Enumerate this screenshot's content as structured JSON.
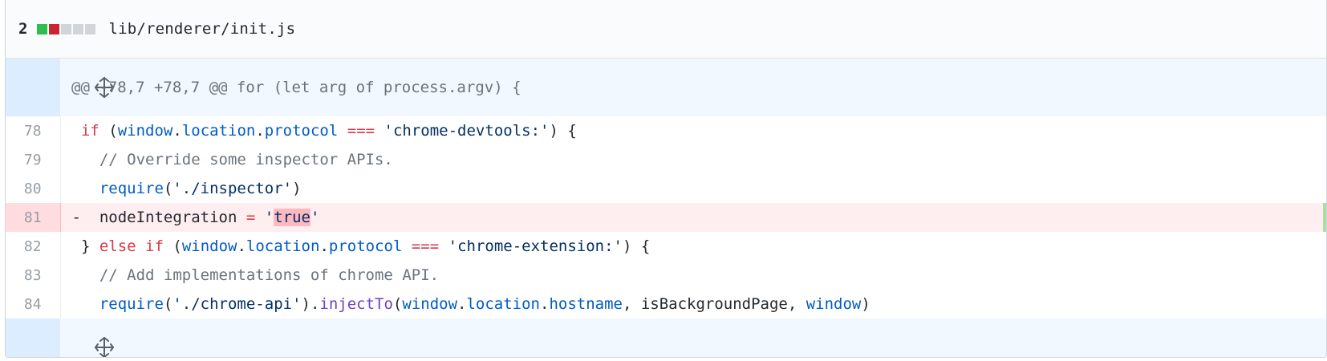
{
  "file": {
    "change_count": "2",
    "path": "lib/renderer/init.js",
    "diffstat_colors": [
      "#2cbe4e",
      "#cb2431",
      "#d1d5da",
      "#d1d5da",
      "#d1d5da"
    ]
  },
  "hunk": {
    "header": "@@ -78,7 +78,7 @@ for (let arg of process.argv) {"
  },
  "lines": [
    {
      "num": "78",
      "tokens": [
        {
          "t": " ",
          "c": ""
        },
        {
          "t": "if",
          "c": "kw"
        },
        {
          "t": " (",
          "c": ""
        },
        {
          "t": "window",
          "c": "id"
        },
        {
          "t": ".",
          "c": ""
        },
        {
          "t": "location",
          "c": "id"
        },
        {
          "t": ".",
          "c": ""
        },
        {
          "t": "protocol",
          "c": "id"
        },
        {
          "t": " ",
          "c": ""
        },
        {
          "t": "===",
          "c": "kw"
        },
        {
          "t": " ",
          "c": ""
        },
        {
          "t": "'chrome-devtools:'",
          "c": "str"
        },
        {
          "t": ") {",
          "c": ""
        }
      ]
    },
    {
      "num": "79",
      "tokens": [
        {
          "t": "   ",
          "c": ""
        },
        {
          "t": "// Override some inspector APIs.",
          "c": "cm"
        }
      ]
    },
    {
      "num": "80",
      "tokens": [
        {
          "t": "   ",
          "c": ""
        },
        {
          "t": "require",
          "c": "id"
        },
        {
          "t": "(",
          "c": ""
        },
        {
          "t": "'./inspector'",
          "c": "str"
        },
        {
          "t": ")",
          "c": ""
        }
      ]
    },
    {
      "num": "81",
      "deleted": true,
      "tokens": [
        {
          "t": "-  nodeIntegration ",
          "c": ""
        },
        {
          "t": "=",
          "c": "kw"
        },
        {
          "t": " ",
          "c": ""
        },
        {
          "t": "'",
          "c": "str"
        },
        {
          "t": "true",
          "c": "str",
          "hl": true
        },
        {
          "t": "'",
          "c": "str"
        }
      ]
    },
    {
      "num": "82",
      "tokens": [
        {
          "t": " } ",
          "c": ""
        },
        {
          "t": "else",
          "c": "kw"
        },
        {
          "t": " ",
          "c": ""
        },
        {
          "t": "if",
          "c": "kw"
        },
        {
          "t": " (",
          "c": ""
        },
        {
          "t": "window",
          "c": "id"
        },
        {
          "t": ".",
          "c": ""
        },
        {
          "t": "location",
          "c": "id"
        },
        {
          "t": ".",
          "c": ""
        },
        {
          "t": "protocol",
          "c": "id"
        },
        {
          "t": " ",
          "c": ""
        },
        {
          "t": "===",
          "c": "kw"
        },
        {
          "t": " ",
          "c": ""
        },
        {
          "t": "'chrome-extension:'",
          "c": "str"
        },
        {
          "t": ") {",
          "c": ""
        }
      ]
    },
    {
      "num": "83",
      "tokens": [
        {
          "t": "   ",
          "c": ""
        },
        {
          "t": "// Add implementations of chrome API.",
          "c": "cm"
        }
      ]
    },
    {
      "num": "84",
      "tokens": [
        {
          "t": "   ",
          "c": ""
        },
        {
          "t": "require",
          "c": "id"
        },
        {
          "t": "(",
          "c": ""
        },
        {
          "t": "'./chrome-api'",
          "c": "str"
        },
        {
          "t": ").",
          "c": ""
        },
        {
          "t": "injectTo",
          "c": "fn"
        },
        {
          "t": "(",
          "c": ""
        },
        {
          "t": "window",
          "c": "id"
        },
        {
          "t": ".",
          "c": ""
        },
        {
          "t": "location",
          "c": "id"
        },
        {
          "t": ".",
          "c": ""
        },
        {
          "t": "hostname",
          "c": "id"
        },
        {
          "t": ", isBackgroundPage, ",
          "c": ""
        },
        {
          "t": "window",
          "c": "id"
        },
        {
          "t": ")",
          "c": ""
        }
      ]
    }
  ],
  "icons": {
    "expand_top": "unfold-icon",
    "expand_bottom": "unfold-icon"
  }
}
